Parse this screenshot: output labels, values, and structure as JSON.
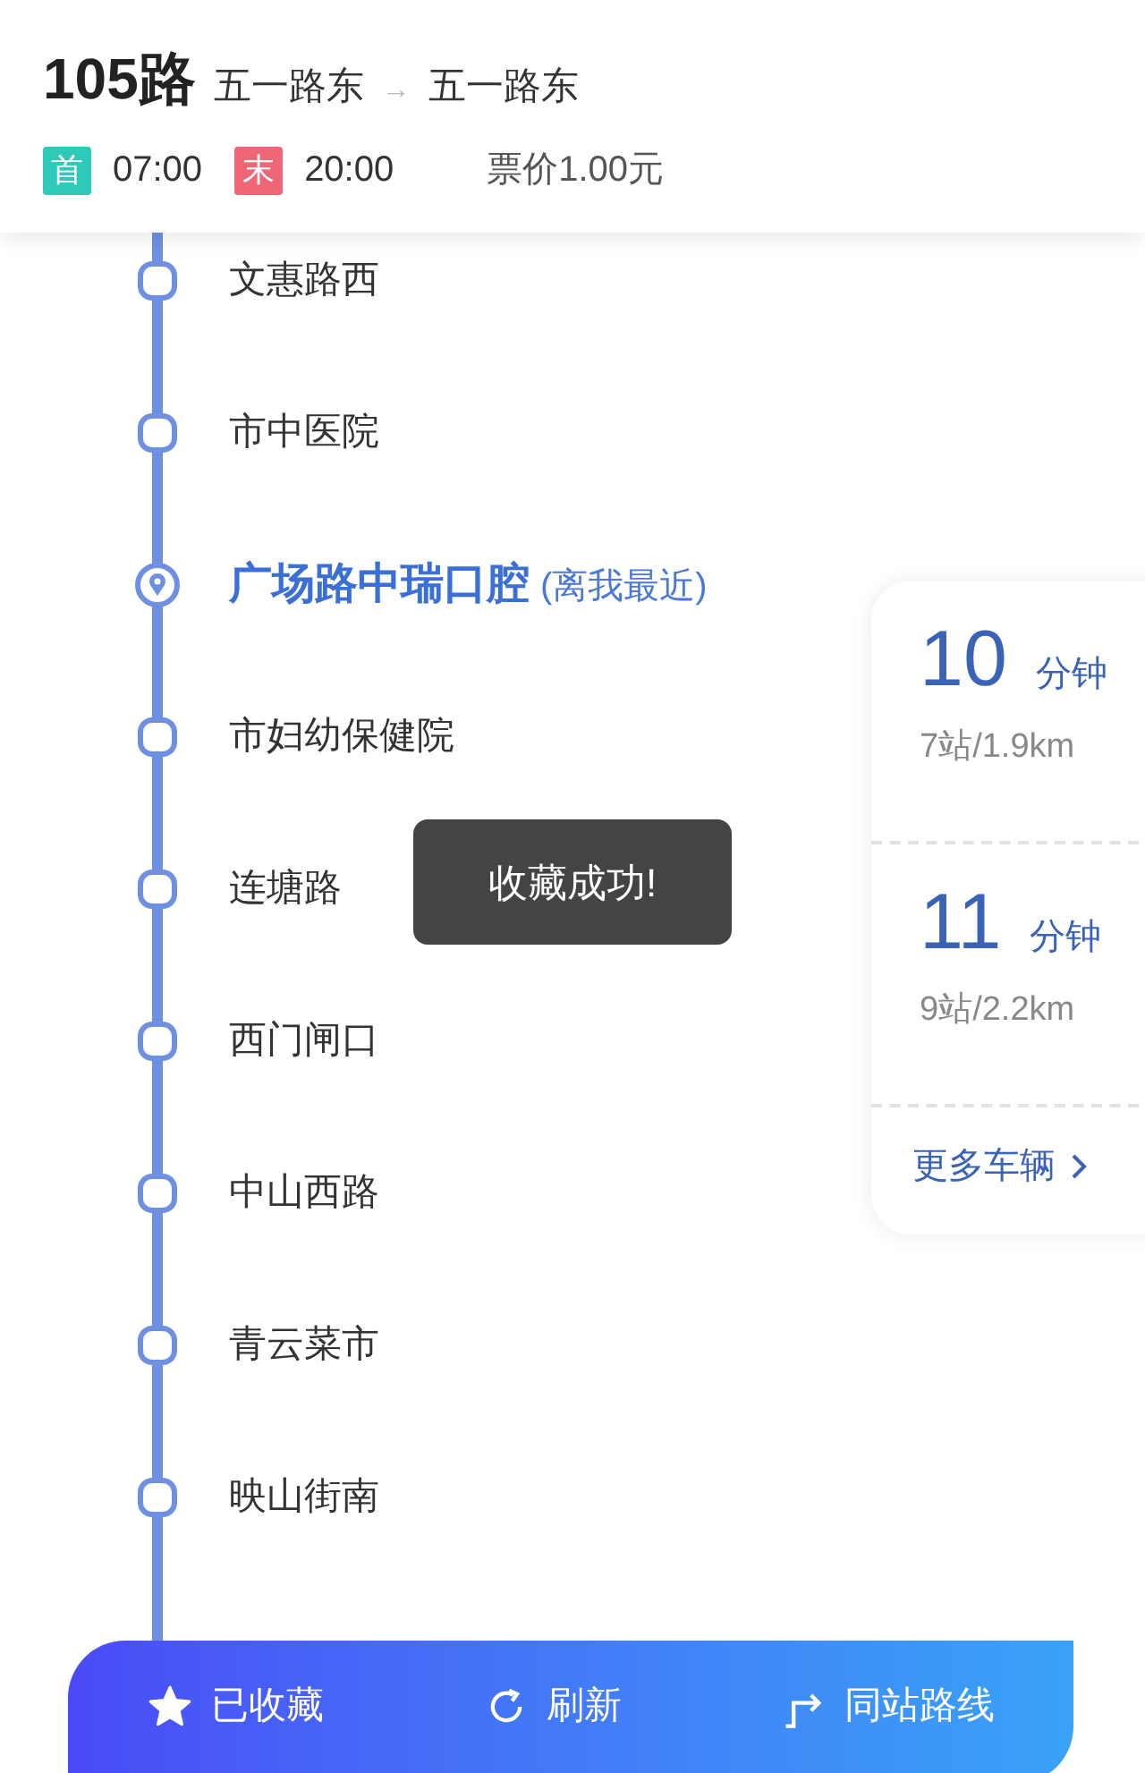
{
  "header": {
    "line": "105路",
    "from": "五一路东",
    "arrow": "→",
    "to": "五一路东",
    "first_label": "首",
    "first_time": "07:00",
    "last_label": "末",
    "last_time": "20:00",
    "fare": "票价1.00元"
  },
  "stops": [
    {
      "name": "文惠路西",
      "current": false
    },
    {
      "name": "市中医院",
      "current": false
    },
    {
      "name": "广场路中瑞口腔",
      "current": true,
      "note": "(离我最近)"
    },
    {
      "name": "市妇幼保健院",
      "current": false
    },
    {
      "name": "连塘路",
      "current": false
    },
    {
      "name": "西门闸口",
      "current": false
    },
    {
      "name": "中山西路",
      "current": false
    },
    {
      "name": "青云菜市",
      "current": false
    },
    {
      "name": "映山街南",
      "current": false
    }
  ],
  "arrivals": [
    {
      "minutes": "10",
      "unit": "分钟",
      "detail": "7站/1.9km"
    },
    {
      "minutes": "11",
      "unit": "分钟",
      "detail": "9站/2.2km"
    }
  ],
  "more_vehicles": "更多车辆",
  "toast": "收藏成功!",
  "bottom_bar": [
    {
      "kind": "star",
      "label": "已收藏"
    },
    {
      "kind": "refresh",
      "label": "刷新"
    },
    {
      "kind": "transfer",
      "label": "同站路线"
    }
  ]
}
